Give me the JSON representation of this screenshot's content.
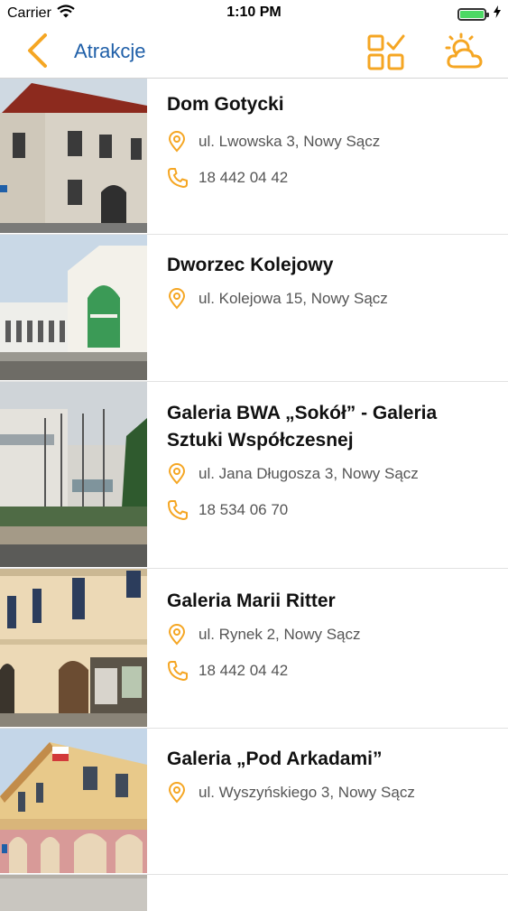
{
  "status_bar": {
    "carrier": "Carrier",
    "time": "1:10 PM"
  },
  "nav": {
    "back_label": "Atrakcje",
    "icons": [
      "back-chevron-icon",
      "checklist-grid-icon",
      "weather-sun-cloud-icon"
    ]
  },
  "colors": {
    "accent": "#f5a623",
    "link": "#1f5fa8"
  },
  "attractions": [
    {
      "name": "Dom Gotycki",
      "address": "ul. Lwowska 3, Nowy Sącz",
      "phone": "18 442 04 42"
    },
    {
      "name": "Dworzec Kolejowy",
      "address": "ul. Kolejowa 15, Nowy Sącz"
    },
    {
      "name_line1": "Galeria BWA „Sokół” - Galeria",
      "name_line2": "Sztuki Współczesnej",
      "address": "ul. Jana Długosza 3, Nowy Sącz",
      "phone": "18 534 06 70"
    },
    {
      "name": "Galeria Marii Ritter",
      "address": "ul. Rynek 2, Nowy Sącz",
      "phone": "18 442 04 42"
    },
    {
      "name": "Galeria „Pod Arkadami”",
      "address": "ul. Wyszyńskiego 3, Nowy Sącz"
    }
  ]
}
